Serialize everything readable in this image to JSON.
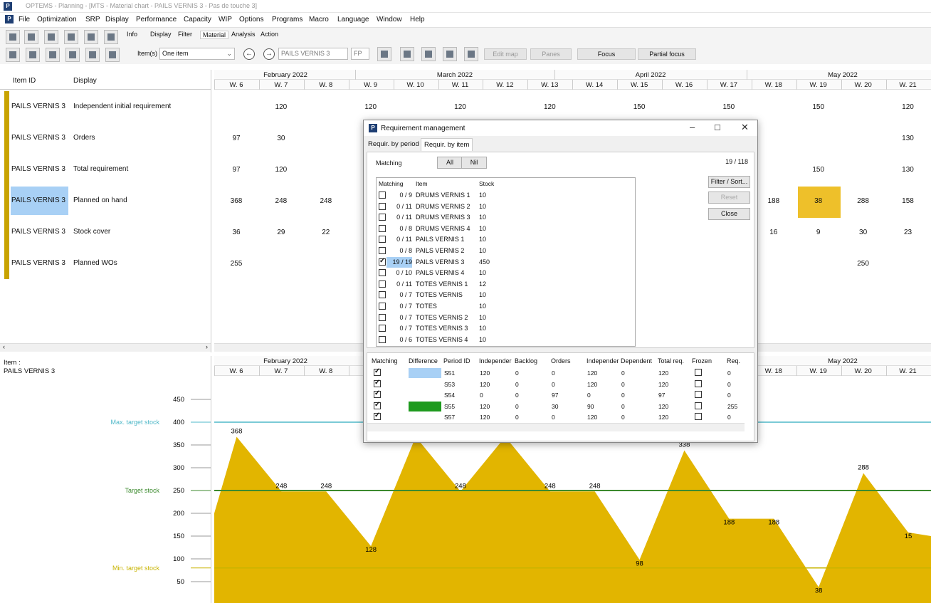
{
  "app": {
    "title": "OPTEMS - Planning - [MTS - Material chart - PAILS VERNIS 3 - Pas de touche 3]",
    "icon": "P"
  },
  "menu": [
    "File",
    "Optimization",
    "SRP",
    "Display",
    "Performance",
    "Capacity",
    "WIP",
    "Options",
    "Programs",
    "Macro",
    "Language",
    "Window",
    "Help"
  ],
  "tabs": [
    "Info",
    "Display",
    "Filter",
    "Material",
    "Analysis",
    "Action"
  ],
  "toolbar2": {
    "items_label": "Item(s)",
    "items_value": "One item",
    "search_value": "PAILS VERNIS 3",
    "fp": "FP",
    "btn_editmap": "Edit map",
    "btn_panes": "Panes",
    "btn_focus": "Focus",
    "btn_partial": "Partial focus"
  },
  "grid": {
    "col_item": "Item ID",
    "col_display": "Display",
    "rows": [
      {
        "id": "PAILS VERNIS 3",
        "display": "Independent initial requirement"
      },
      {
        "id": "PAILS VERNIS 3",
        "display": "Orders"
      },
      {
        "id": "PAILS VERNIS 3",
        "display": "Total requirement"
      },
      {
        "id": "PAILS VERNIS 3",
        "display": "Planned on hand"
      },
      {
        "id": "PAILS VERNIS 3",
        "display": "Stock cover"
      },
      {
        "id": "PAILS VERNIS 3",
        "display": "Planned WOs"
      }
    ]
  },
  "timeline": {
    "months": [
      "February 2022",
      "March 2022",
      "April 2022",
      "May 2022"
    ],
    "weeks": [
      "W. 6",
      "W. 7",
      "W. 8",
      "W. 9",
      "W. 10",
      "W. 11",
      "W. 12",
      "W. 13",
      "W. 14",
      "W. 15",
      "W. 16",
      "W. 17",
      "W. 18",
      "W. 19",
      "W. 20",
      "W. 21"
    ]
  },
  "values": {
    "r0": [
      [
        "W. 7",
        "120"
      ],
      [
        "W. 9",
        "120"
      ],
      [
        "W. 11",
        "120"
      ],
      [
        "W. 13",
        "120"
      ],
      [
        "W. 15",
        "150"
      ],
      [
        "W. 17",
        "150"
      ],
      [
        "W. 19",
        "150"
      ],
      [
        "W. 21",
        "120"
      ]
    ],
    "r1": [
      [
        "W. 6",
        "97"
      ],
      [
        "W. 7",
        "30"
      ],
      [
        "W. 21",
        "130"
      ]
    ],
    "r2": [
      [
        "W. 6",
        "97"
      ],
      [
        "W. 7",
        "120"
      ],
      [
        "W. 19",
        "150"
      ],
      [
        "W. 21",
        "130"
      ]
    ],
    "r3": [
      [
        "W. 6",
        "368"
      ],
      [
        "W. 7",
        "248"
      ],
      [
        "W. 8",
        "248"
      ],
      [
        "W. 18",
        "188"
      ],
      [
        "W. 19",
        "38"
      ],
      [
        "W. 20",
        "288"
      ],
      [
        "W. 21",
        "158"
      ]
    ],
    "r4": [
      [
        "W. 6",
        "36"
      ],
      [
        "W. 7",
        "29"
      ],
      [
        "W. 8",
        "22"
      ],
      [
        "W. 18",
        "16"
      ],
      [
        "W. 19",
        "9"
      ],
      [
        "W. 20",
        "30"
      ],
      [
        "W. 21",
        "23"
      ]
    ],
    "r5": [
      [
        "W. 6",
        "255"
      ],
      [
        "W. 20",
        "250"
      ]
    ]
  },
  "dialog": {
    "title": "Requirement management",
    "tab1": "Requir. by period",
    "tab2": "Requir. by item",
    "matching": "Matching",
    "all": "All",
    "nil": "Nil",
    "count": "19 / 118",
    "list_headers": [
      "Matching",
      "Item",
      "Stock"
    ],
    "list": [
      {
        "m": "0 / 9",
        "item": "DRUMS VERNIS 1",
        "stock": "10",
        "checked": false
      },
      {
        "m": "0 / 11",
        "item": "DRUMS VERNIS 2",
        "stock": "10",
        "checked": false
      },
      {
        "m": "0 / 11",
        "item": "DRUMS VERNIS 3",
        "stock": "10",
        "checked": false
      },
      {
        "m": "0 / 8",
        "item": "DRUMS VERNIS 4",
        "stock": "10",
        "checked": false
      },
      {
        "m": "0 / 11",
        "item": "PAILS VERNIS 1",
        "stock": "10",
        "checked": false
      },
      {
        "m": "0 / 8",
        "item": "PAILS VERNIS 2",
        "stock": "10",
        "checked": false
      },
      {
        "m": "19 / 19",
        "item": "PAILS VERNIS 3",
        "stock": "450",
        "checked": true
      },
      {
        "m": "0 / 10",
        "item": "PAILS VERNIS 4",
        "stock": "10",
        "checked": false
      },
      {
        "m": "0 / 11",
        "item": "TOTES VERNIS 1",
        "stock": "12",
        "checked": false
      },
      {
        "m": "0 / 7",
        "item": "TOTES VERNIS",
        "stock": "10",
        "checked": false
      },
      {
        "m": "0 / 7",
        "item": "TOTES",
        "stock": "10",
        "checked": false
      },
      {
        "m": "0 / 7",
        "item": "TOTES VERNIS 2",
        "stock": "10",
        "checked": false
      },
      {
        "m": "0 / 7",
        "item": "TOTES VERNIS 3",
        "stock": "10",
        "checked": false
      },
      {
        "m": "0 / 6",
        "item": "TOTES VERNIS 4",
        "stock": "10",
        "checked": false
      }
    ],
    "btn_filter": "Filter / Sort...",
    "btn_reset": "Reset",
    "btn_close": "Close",
    "table_headers": [
      "Matching",
      "Difference",
      "Period ID",
      "Independer",
      "Backlog",
      "Orders",
      "Independer",
      "Dependent",
      "Total req.",
      "Frozen",
      "Req."
    ],
    "table_rows": [
      {
        "pid": "S51",
        "ind": "120",
        "back": "0",
        "ord": "0",
        "ind2": "120",
        "dep": "0",
        "tot": "120",
        "req": "0",
        "diff": "#a8d0f5"
      },
      {
        "pid": "S53",
        "ind": "120",
        "back": "0",
        "ord": "0",
        "ind2": "120",
        "dep": "0",
        "tot": "120",
        "req": "0",
        "diff": ""
      },
      {
        "pid": "S54",
        "ind": "0",
        "back": "0",
        "ord": "97",
        "ind2": "0",
        "dep": "0",
        "tot": "97",
        "req": "0",
        "diff": ""
      },
      {
        "pid": "S55",
        "ind": "120",
        "back": "0",
        "ord": "30",
        "ind2": "90",
        "dep": "0",
        "tot": "120",
        "req": "255",
        "diff": "#1e9a1e"
      },
      {
        "pid": "S57",
        "ind": "120",
        "back": "0",
        "ord": "0",
        "ind2": "120",
        "dep": "0",
        "tot": "120",
        "req": "0",
        "diff": ""
      }
    ]
  },
  "chart_panel": {
    "item_label": "Item :",
    "item_value": "PAILS VERNIS 3"
  },
  "chart_data": {
    "type": "area",
    "y_ticks": [
      450,
      400,
      350,
      300,
      250,
      200,
      150,
      100,
      50
    ],
    "ylim": [
      0,
      480
    ],
    "lines": [
      {
        "name": "Max. target stock",
        "value": 400,
        "color": "#4fb8c8"
      },
      {
        "name": "Target stock",
        "value": 250,
        "color": "#3c8a2e"
      },
      {
        "name": "Min. target stock",
        "value": 80,
        "color": "#c8b400"
      }
    ],
    "points": [
      [
        0,
        200
      ],
      [
        1,
        368
      ],
      [
        2,
        248
      ],
      [
        3,
        248
      ],
      [
        4,
        128
      ],
      [
        5,
        368
      ],
      [
        6,
        248
      ],
      [
        7,
        368
      ],
      [
        8,
        248
      ],
      [
        9,
        248
      ],
      [
        10,
        98
      ],
      [
        11,
        338
      ],
      [
        12,
        188
      ],
      [
        13,
        188
      ],
      [
        14,
        38
      ],
      [
        15,
        288
      ],
      [
        16,
        158
      ]
    ],
    "labels": [
      "",
      "368",
      "248",
      "248",
      "128",
      "",
      "248",
      "",
      "248",
      "248",
      "98",
      "338",
      "188",
      "188",
      "38",
      "288",
      "15"
    ],
    "color": "#e2b500"
  }
}
